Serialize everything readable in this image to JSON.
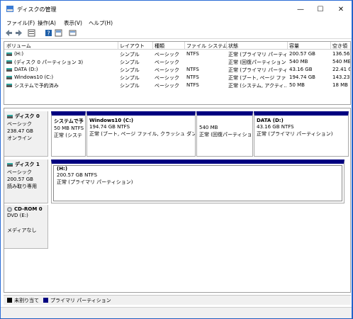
{
  "window": {
    "title": "ディスクの管理",
    "min_glyph": "—",
    "max_glyph": "☐",
    "close_glyph": "✕"
  },
  "menu": [
    "ファイル(F)",
    "操作(A)",
    "表示(V)",
    "ヘルプ(H)"
  ],
  "columns": [
    "ボリューム",
    "レイアウト",
    "種類",
    "ファイル システム",
    "状態",
    "容量",
    "空き領"
  ],
  "volumes": [
    [
      "(H:)",
      "シンプル",
      "ベーシック",
      "NTFS",
      "正常 (プライマリ パーティ...",
      "200.57 GB",
      "136.56"
    ],
    [
      "(ディスク 0 パーティション 3)",
      "シンプル",
      "ベーシック",
      "",
      "正常 (回復パーティション)",
      "540 MB",
      "540 ME"
    ],
    [
      "DATA (D:)",
      "シンプル",
      "ベーシック",
      "NTFS",
      "正常 (プライマリ パーティ...",
      "43.16 GB",
      "22.41 G"
    ],
    [
      "Windows10 (C:)",
      "シンプル",
      "ベーシック",
      "NTFS",
      "正常 (ブート, ページ ファ...",
      "194.74 GB",
      "143.23"
    ],
    [
      "システムで予約済み",
      "シンプル",
      "ベーシック",
      "NTFS",
      "正常 (システム, アクティ...",
      "50 MB",
      "18 MB"
    ]
  ],
  "disks": {
    "disk0": {
      "name": "ディスク 0",
      "type": "ベーシック",
      "size": "238.47 GB",
      "status": "オンライン",
      "partitions": [
        {
          "name": "システムで予",
          "size": "50 MB NTFS",
          "status": "正常 (システ"
        },
        {
          "name": "Windows10  (C:)",
          "size": "194.74 GB NTFS",
          "status": "正常 (ブート, ページ ファイル, クラッシュ ダンプ, プ"
        },
        {
          "name": "",
          "size": "540 MB",
          "status": "正常 (回復パーティショ"
        },
        {
          "name": "DATA  (D:)",
          "size": "43.16 GB NTFS",
          "status": "正常 (プライマリ パーティション)"
        }
      ]
    },
    "disk1": {
      "name": "ディスク 1",
      "type": "ベーシック",
      "size": "200.57 GB",
      "status": "読み取り専用",
      "partitions": [
        {
          "name": "(H:)",
          "size": "200.57 GB NTFS",
          "status": "正常 (プライマリ パーティション)"
        }
      ]
    },
    "cdrom0": {
      "name": "CD-ROM 0",
      "type": "DVD (E:)",
      "status": "メディアなし"
    }
  },
  "legend": {
    "unallocated": "未割り当て",
    "primary": "プライマリ パーティション"
  },
  "colors": {
    "primary": "#000080",
    "unallocated": "#000000",
    "accent": "#2b6cd6"
  }
}
